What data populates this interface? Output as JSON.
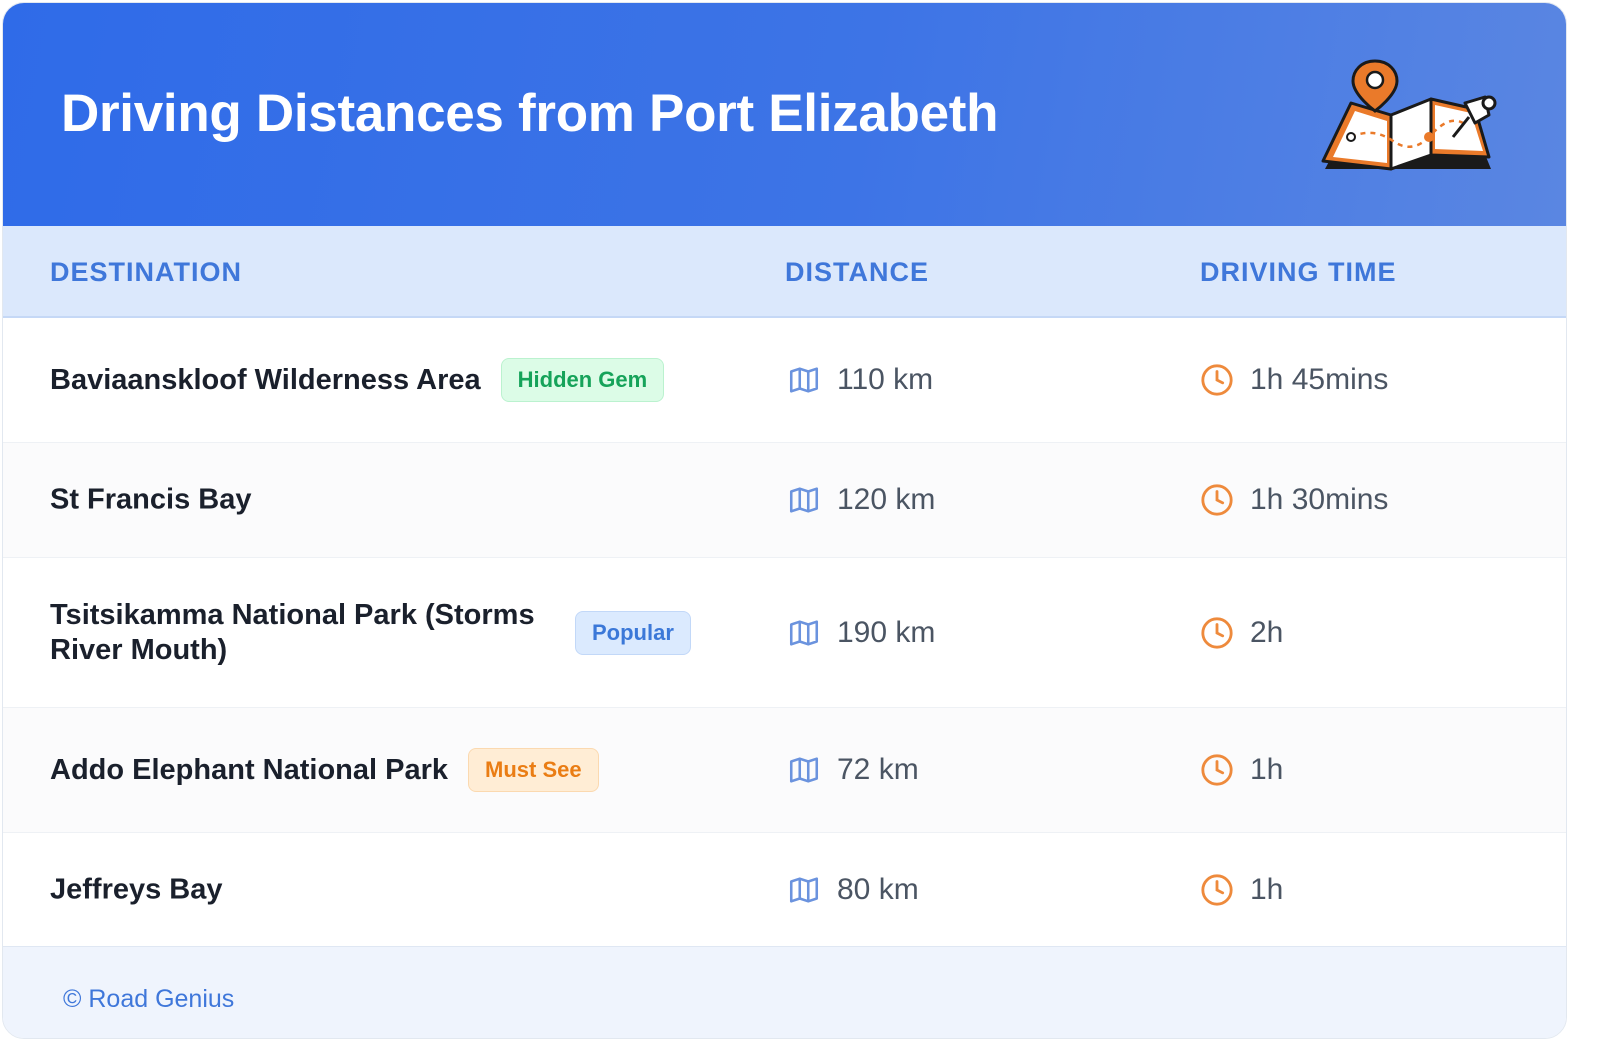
{
  "header": {
    "title": "Driving Distances from Port Elizabeth",
    "illustration_icon": "map-with-pins-icon"
  },
  "table": {
    "columns": [
      "DESTINATION",
      "DISTANCE",
      "DRIVING TIME"
    ],
    "rows": [
      {
        "destination": "Baviaanskloof Wilderness Area",
        "badge": "Hidden Gem",
        "badge_color": "green",
        "distance": "110 km",
        "time": "1h 45mins"
      },
      {
        "destination": "St Francis Bay",
        "badge": "",
        "badge_color": "",
        "distance": "120 km",
        "time": "1h 30mins"
      },
      {
        "destination": "Tsitsikamma National Park (Storms River Mouth)",
        "badge": "Popular",
        "badge_color": "blue",
        "distance": "190 km",
        "time": "2h"
      },
      {
        "destination": "Addo Elephant National Park",
        "badge": "Must See",
        "badge_color": "orange",
        "distance": "72 km",
        "time": "1h"
      },
      {
        "destination": "Jeffreys Bay",
        "badge": "",
        "badge_color": "",
        "distance": "80 km",
        "time": "1h"
      }
    ],
    "distance_icon": "map-icon",
    "time_icon": "clock-icon"
  },
  "footer": {
    "text": "© Road Genius"
  },
  "colors": {
    "header_gradient_start": "#2f6be8",
    "header_gradient_end": "#5a86e2",
    "accent_blue": "#3f77da",
    "icon_orange": "#ee8a3c",
    "icon_blue": "#6b93de"
  }
}
